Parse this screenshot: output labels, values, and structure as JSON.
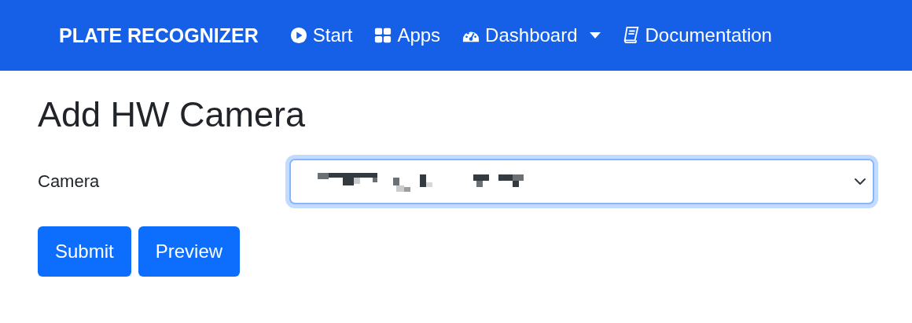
{
  "navbar": {
    "brand": "PLATE RECOGNIZER",
    "items": [
      {
        "label": "Start",
        "kind": "play",
        "dropdown": false
      },
      {
        "label": "Apps",
        "kind": "grid",
        "dropdown": false
      },
      {
        "label": "Dashboard",
        "kind": "gauge",
        "dropdown": true
      },
      {
        "label": "Documentation",
        "kind": "book",
        "dropdown": false
      }
    ]
  },
  "heading": "Add HW Camera",
  "form": {
    "label": "Camera",
    "select": {
      "focused": true
    }
  },
  "buttons": [
    "Submit",
    "Preview"
  ]
}
